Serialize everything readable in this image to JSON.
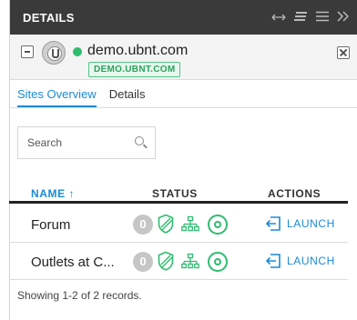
{
  "header": {
    "title": "DETAILS",
    "icons": [
      "arrows-horizontal-icon",
      "filter-lines-icon",
      "hamburger-icon",
      "double-chevron-right-icon"
    ]
  },
  "device": {
    "name": "demo.ubnt.com",
    "tag": "DEMO.UBNT.COM",
    "status_color": "#2ebc6f"
  },
  "tabs": [
    {
      "label": "Sites Overview",
      "active": true
    },
    {
      "label": "Details",
      "active": false
    }
  ],
  "search": {
    "placeholder": "Search"
  },
  "table": {
    "columns": {
      "name": "NAME ↑",
      "status": "STATUS",
      "actions": "ACTIONS"
    },
    "rows": [
      {
        "name": "Forum",
        "badge": "0",
        "action": "LAUNCH"
      },
      {
        "name": "Outlets at C...",
        "badge": "0",
        "action": "LAUNCH"
      }
    ]
  },
  "footer": "Showing 1-2 of 2 records.",
  "colors": {
    "accent": "#1c8ad6",
    "success": "#2ebc6f",
    "header_bg": "#3a3a3a"
  }
}
